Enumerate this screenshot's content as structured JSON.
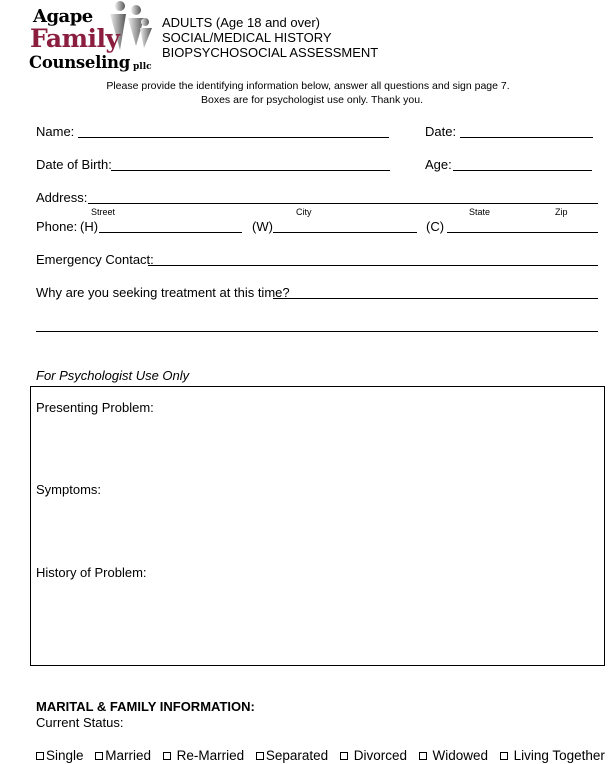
{
  "logo": {
    "line1": "Agape",
    "line2": "Family",
    "line3": "Counseling",
    "suffix": "pllc",
    "brand_color": "#8b1e3f",
    "icon": "people-figures-icon"
  },
  "header": {
    "title_lines": [
      "ADULTS (Age 18 and over)",
      "SOCIAL/MEDICAL HISTORY",
      "BIOPSYCHOSOCIAL ASSESSMENT"
    ],
    "instructions": [
      "Please provide the identifying information below, answer all questions and sign page 7.",
      "Boxes are for psychologist use only.  Thank you."
    ]
  },
  "fields": {
    "name": "Name:",
    "date": "Date:",
    "dob": "Date of Birth:",
    "age": "Age:",
    "address": "Address:",
    "address_sublabels": [
      "Street",
      "City",
      "State",
      "Zip"
    ],
    "phone": "Phone:",
    "phone_home": "(H)",
    "phone_work": "(W)",
    "phone_cell": "(C)",
    "emergency": "Emergency Contact:",
    "reason": "Why are you seeking treatment at this time?"
  },
  "psychologist": {
    "caption": "For Psychologist Use Only",
    "sections": [
      "Presenting Problem:",
      "Symptoms:",
      "History of Problem:"
    ]
  },
  "marital": {
    "heading": "MARITAL & FAMILY INFORMATION:",
    "subheading": "Current Status:",
    "options": [
      "Single",
      "Married",
      "Re-Married",
      "Separated",
      "Divorced",
      "Widowed",
      "Living Together"
    ]
  }
}
